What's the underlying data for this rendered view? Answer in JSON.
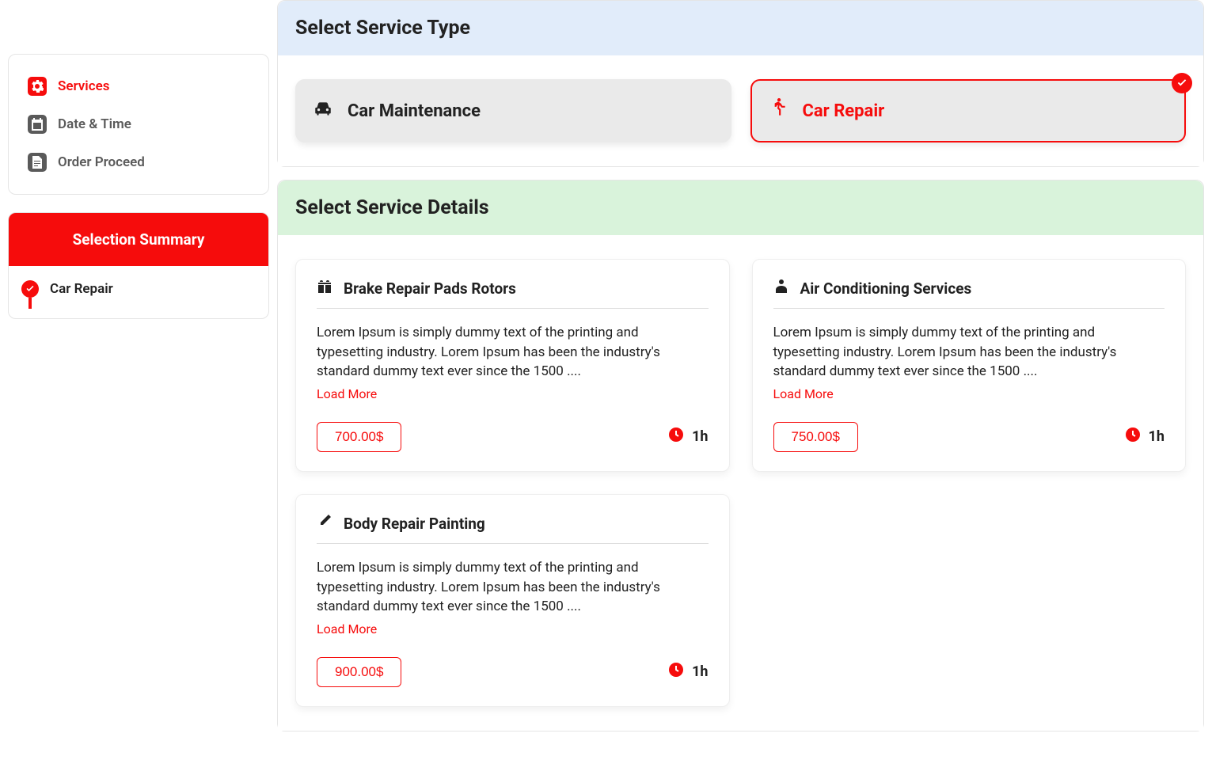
{
  "steps": [
    {
      "label": "Services",
      "active": true
    },
    {
      "label": "Date & Time",
      "active": false
    },
    {
      "label": "Order Proceed",
      "active": false
    }
  ],
  "summary": {
    "title": "Selection Summary",
    "items": [
      "Car Repair"
    ]
  },
  "serviceType": {
    "title": "Select Service Type",
    "options": [
      {
        "label": "Car Maintenance",
        "selected": false
      },
      {
        "label": "Car Repair",
        "selected": true
      }
    ]
  },
  "serviceDetails": {
    "title": "Select Service Details",
    "loadMore": "Load More",
    "cards": [
      {
        "title": "Brake Repair Pads Rotors",
        "desc": "Lorem Ipsum is simply dummy text of the printing and typesetting industry. Lorem Ipsum has been the industry's standard dummy text ever since the 1500 ....",
        "price": "700.00$",
        "time": "1h"
      },
      {
        "title": "Air Conditioning Services",
        "desc": "Lorem Ipsum is simply dummy text of the printing and typesetting industry. Lorem Ipsum has been the industry's standard dummy text ever since the 1500 ....",
        "price": "750.00$",
        "time": "1h"
      },
      {
        "title": "Body Repair Painting",
        "desc": "Lorem Ipsum is simply dummy text of the printing and typesetting industry. Lorem Ipsum has been the industry's standard dummy text ever since the 1500 ....",
        "price": "900.00$",
        "time": "1h"
      }
    ]
  }
}
